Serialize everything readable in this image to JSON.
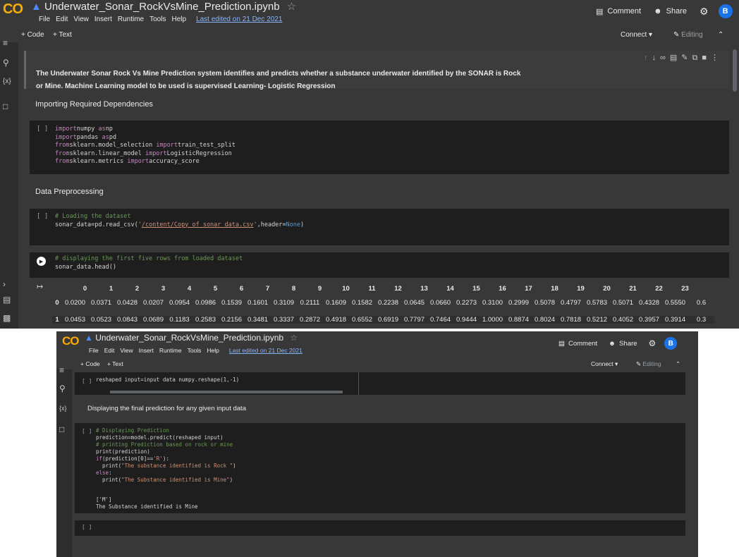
{
  "header": {
    "logo": "CO",
    "title": "Underwater_Sonar_RockVsMine_Prediction.ipynb",
    "menu": [
      "File",
      "Edit",
      "View",
      "Insert",
      "Runtime",
      "Tools",
      "Help"
    ],
    "last_edited": "Last edited on 21 Dec 2021",
    "comment": "Comment",
    "share": "Share",
    "avatar": "B"
  },
  "toolbar": {
    "add_code": "+ Code",
    "add_text": "+ Text",
    "connect": "Connect",
    "editing": "Editing"
  },
  "window1": {
    "intro_text": "The Underwater Sonar Rock Vs Mine Prediction system identifies and predicts whether a substance underwater identified by the SONAR is Rock or Mine. Machine Learning model to be used is supervised Learning- Logistic Regression",
    "heading_imports": "Importing Required Dependencies",
    "imports_code": [
      [
        "kw",
        "import"
      ],
      [
        "",
        "numpy "
      ],
      [
        "kw",
        "as"
      ],
      [
        "",
        "np\n"
      ],
      [
        "kw",
        "import"
      ],
      [
        "",
        "pandas "
      ],
      [
        "kw",
        "as"
      ],
      [
        "",
        "pd\n"
      ],
      [
        "kw",
        "from"
      ],
      [
        "",
        "sklearn.model_selection "
      ],
      [
        "kw",
        "import"
      ],
      [
        "",
        "train_test_split\n"
      ],
      [
        "kw",
        "from"
      ],
      [
        "",
        "sklearn.linear_model "
      ],
      [
        "kw",
        "import"
      ],
      [
        "",
        "LogisticRegression\n"
      ],
      [
        "kw",
        "from"
      ],
      [
        "",
        "sklearn.metrics "
      ],
      [
        "kw",
        "import"
      ],
      [
        "",
        "accuracy_score"
      ]
    ],
    "heading_preprocessing": "Data Preprocessing",
    "load_code": [
      [
        "cm",
        "# Loading the dataset\n"
      ],
      [
        "",
        "sonar_data=pd.read_csv("
      ],
      [
        "st",
        "'"
      ],
      [
        "lk",
        "/content/Copy_of_sonar_data.csv"
      ],
      [
        "st",
        "'"
      ],
      [
        "",
        ",header="
      ],
      [
        "bl",
        "None"
      ],
      [
        "",
        ")"
      ]
    ],
    "head_code": [
      [
        "cm",
        "# displaying the first five rows from loaded dataset\n"
      ],
      [
        "",
        "sonar_data.head()"
      ]
    ],
    "df_columns": [
      "0",
      "1",
      "2",
      "3",
      "4",
      "5",
      "6",
      "7",
      "8",
      "9",
      "10",
      "11",
      "12",
      "13",
      "14",
      "15",
      "16",
      "17",
      "18",
      "19",
      "20",
      "21",
      "22",
      "23"
    ],
    "df_rows": [
      {
        "index": "0",
        "values": [
          "0.0200",
          "0.0371",
          "0.0428",
          "0.0207",
          "0.0954",
          "0.0986",
          "0.1539",
          "0.1601",
          "0.3109",
          "0.2111",
          "0.1609",
          "0.1582",
          "0.2238",
          "0.0645",
          "0.0660",
          "0.2273",
          "0.3100",
          "0.2999",
          "0.5078",
          "0.4797",
          "0.5783",
          "0.5071",
          "0.4328",
          "0.5550",
          "0.6"
        ]
      },
      {
        "index": "1",
        "values": [
          "0.0453",
          "0.0523",
          "0.0843",
          "0.0689",
          "0.1183",
          "0.2583",
          "0.2156",
          "0.3481",
          "0.3337",
          "0.2872",
          "0.4918",
          "0.6552",
          "0.6919",
          "0.7797",
          "0.7464",
          "0.9444",
          "1.0000",
          "0.8874",
          "0.8024",
          "0.7818",
          "0.5212",
          "0.4052",
          "0.3957",
          "0.3914",
          "0.3"
        ]
      }
    ]
  },
  "window2": {
    "reshape_code": [
      [
        "",
        "reshaped input=input data numpy.reshape(1,-1)"
      ]
    ],
    "heading_final": "Displaying the final prediction for any given input data",
    "predict_code": [
      [
        "cm",
        "# Displaying Prediction\n"
      ],
      [
        "",
        "prediction=model.predict(reshaped input)\n"
      ],
      [
        "cm",
        "# printing Prediction based on rock or mine\n"
      ],
      [
        "",
        "print(prediction)\n"
      ],
      [
        "kw",
        "if"
      ],
      [
        "",
        "(prediction[0]=="
      ],
      [
        "st",
        "'R'"
      ],
      [
        "",
        "):\n"
      ],
      [
        "",
        "  print("
      ],
      [
        "st",
        "\"The substance identified is Rock \""
      ],
      [
        "",
        ")\n"
      ],
      [
        "kw",
        "else"
      ],
      [
        "",
        ":\n"
      ],
      [
        "",
        "  print("
      ],
      [
        "st",
        "\"The Substance identified is Mine\""
      ],
      [
        "",
        ")"
      ]
    ],
    "output_lines": [
      "['M']",
      "The Substance identified is Mine"
    ]
  },
  "empty_cell_brackets": "[ ]"
}
